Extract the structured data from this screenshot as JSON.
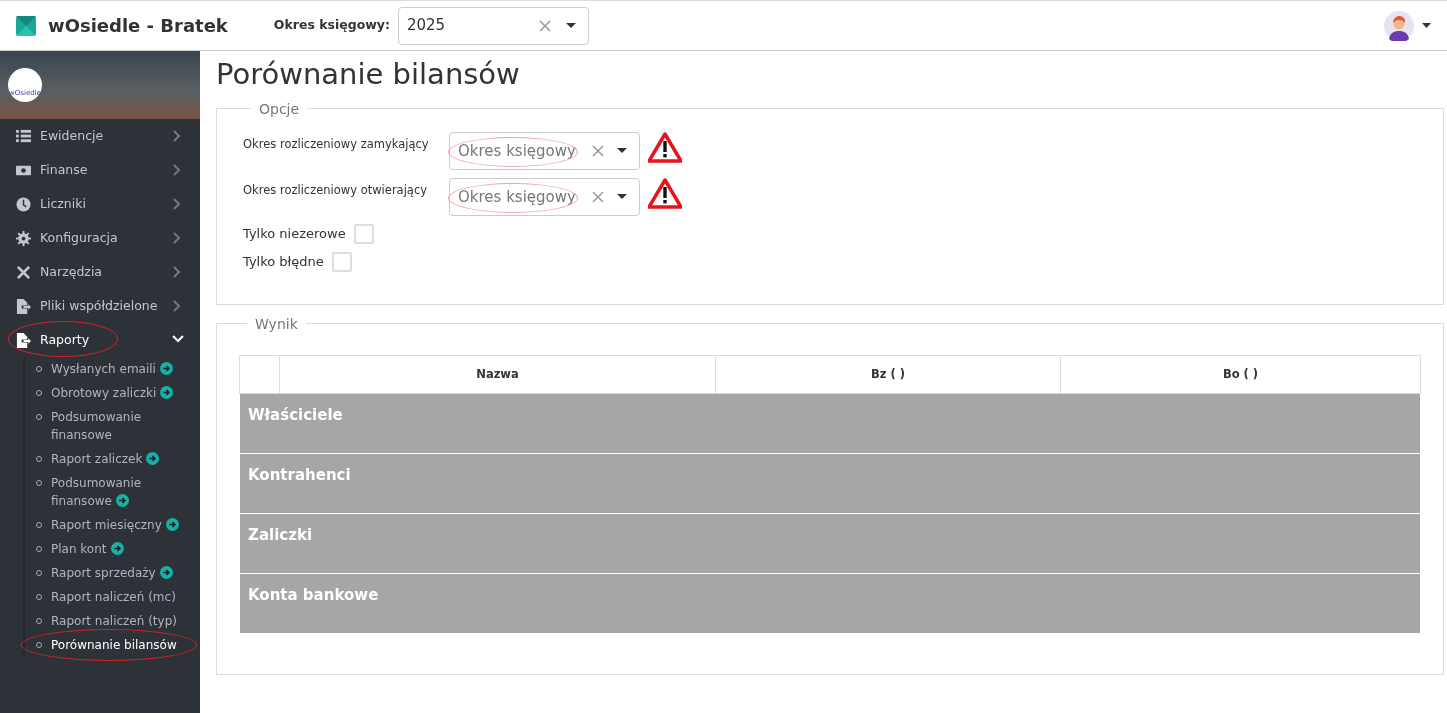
{
  "app": {
    "title": "wOsiedle - Bratek"
  },
  "period": {
    "label": "Okres księgowy:",
    "value": "2025"
  },
  "sidebar": {
    "logo_text": "wOsiedle",
    "items": [
      {
        "label": "Ewidencje",
        "expanded": false,
        "circled": false
      },
      {
        "label": "Finanse",
        "expanded": false,
        "circled": false
      },
      {
        "label": "Liczniki",
        "expanded": false,
        "circled": false
      },
      {
        "label": "Konfiguracja",
        "expanded": false,
        "circled": false
      },
      {
        "label": "Narzędzia",
        "expanded": false,
        "circled": false
      },
      {
        "label": "Pliki współdzielone",
        "expanded": false,
        "circled": false
      },
      {
        "label": "Raporty",
        "expanded": true,
        "circled": true,
        "children": [
          {
            "label": "Wysłanych emaili",
            "shortcut": true,
            "selected": false,
            "circled": false
          },
          {
            "label": "Obrotowy zaliczki",
            "shortcut": true,
            "selected": false,
            "circled": false
          },
          {
            "label": "Podsumowanie finansowe",
            "shortcut": false,
            "selected": false,
            "circled": false
          },
          {
            "label": "Raport zaliczek",
            "shortcut": true,
            "selected": false,
            "circled": false
          },
          {
            "label": "Podsumowanie finansowe",
            "shortcut": true,
            "selected": false,
            "circled": false
          },
          {
            "label": "Raport miesięczny",
            "shortcut": true,
            "selected": false,
            "circled": false
          },
          {
            "label": "Plan kont",
            "shortcut": true,
            "selected": false,
            "circled": false
          },
          {
            "label": "Raport sprzedaży",
            "shortcut": true,
            "selected": false,
            "circled": false
          },
          {
            "label": "Raport naliczeń (mc)",
            "shortcut": false,
            "selected": false,
            "circled": false
          },
          {
            "label": "Raport naliczeń (typ)",
            "shortcut": false,
            "selected": false,
            "circled": false
          },
          {
            "label": "Porównanie bilansów",
            "shortcut": false,
            "selected": true,
            "circled": true
          }
        ]
      }
    ]
  },
  "page_title": "Porównanie bilansów",
  "options": {
    "legend": "Opcje",
    "fields": [
      {
        "label": "Okres rozliczeniowy zamykający",
        "placeholder": "Okres księgowy",
        "circled": true,
        "warning": true
      },
      {
        "label": "Okres rozliczeniowy otwierający",
        "placeholder": "Okres księgowy",
        "circled": true,
        "warning": true
      }
    ],
    "checkboxes": [
      {
        "label": "Tylko niezerowe",
        "checked": false
      },
      {
        "label": "Tylko błędne",
        "checked": false
      }
    ]
  },
  "result": {
    "legend": "Wynik",
    "columns": [
      "",
      "Nazwa",
      "Bz ( )",
      "Bo ( )"
    ],
    "groups": [
      "Właściciele",
      "Kontrahenci",
      "Zaliczki",
      "Konta bankowe"
    ]
  }
}
